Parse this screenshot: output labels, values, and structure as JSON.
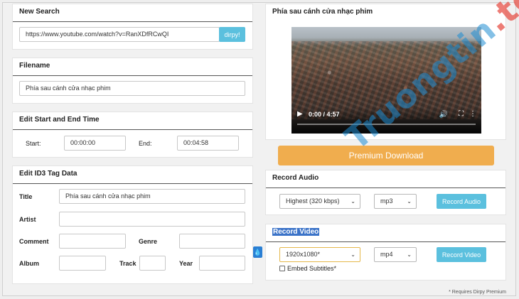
{
  "new_search": {
    "title": "New Search",
    "url_value": "https://www.youtube.com/watch?v=RanXDfRCwQI",
    "submit_label": "dirpy!"
  },
  "filename": {
    "title": "Filename",
    "value": "Phía sau cánh cửa nhạc phim"
  },
  "edit_time": {
    "title": "Edit Start and End Time",
    "start_label": "Start:",
    "start_value": "00:00:00",
    "end_label": "End:",
    "end_value": "00:04:58"
  },
  "id3": {
    "title": "Edit ID3 Tag Data",
    "title_label": "Title",
    "title_value": "Phía sau cánh cửa nhạc phim",
    "artist_label": "Artist",
    "comment_label": "Comment",
    "genre_label": "Genre",
    "album_label": "Album",
    "track_label": "Track",
    "year_label": "Year"
  },
  "preview": {
    "title": "Phía sau cánh cửa nhạc phim",
    "time": "0:00 / 4:57"
  },
  "premium_button": "Premium Download",
  "record_audio": {
    "title": "Record Audio",
    "quality": "Highest (320 kbps)",
    "format": "mp3",
    "button": "Record Audio"
  },
  "record_video": {
    "title": "Record Video",
    "resolution": "1920x1080*",
    "format": "mp4",
    "button": "Record Video",
    "embed_subtitles": "Embed Subtitles*"
  },
  "footnote": "* Requires Dirpy Premium",
  "watermark": {
    "main": "Truongtin",
    "suffix": ".top"
  },
  "icons": {
    "play": "▶",
    "volume": "🔊",
    "fullscreen": "⛶",
    "more": "⋮",
    "chevron": "⌄",
    "drop": "💧"
  },
  "colors": {
    "accent_teal": "#5bc0de",
    "premium_orange": "#f0ad4e",
    "drop_blue": "#2a7fd4"
  }
}
